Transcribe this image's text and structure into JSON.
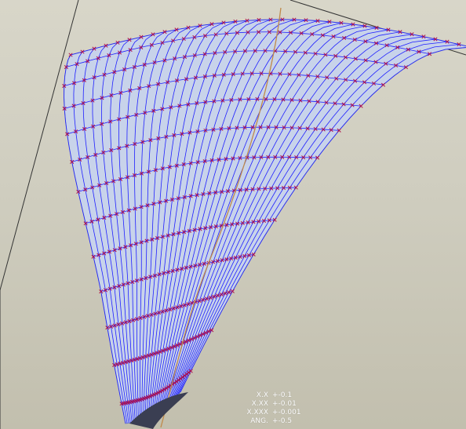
{
  "viewport": {
    "background_top": "#d8d6c9",
    "background_bottom": "#c2bfae",
    "surface_fill": "#c8d3ea",
    "isoline_color": "#2020ff",
    "point_marker_color": "#b0104a",
    "spine_curve_color": "#c08a4a",
    "datum_plane_color": "#333333"
  },
  "tolerance_table": {
    "rows": [
      {
        "key": "X.X",
        "value": "+-0.1"
      },
      {
        "key": "X.XX",
        "value": "+-0.01"
      },
      {
        "key": "X.XXX",
        "value": "+-0.001"
      },
      {
        "key": "ANG.",
        "value": "+-0.5"
      }
    ]
  }
}
